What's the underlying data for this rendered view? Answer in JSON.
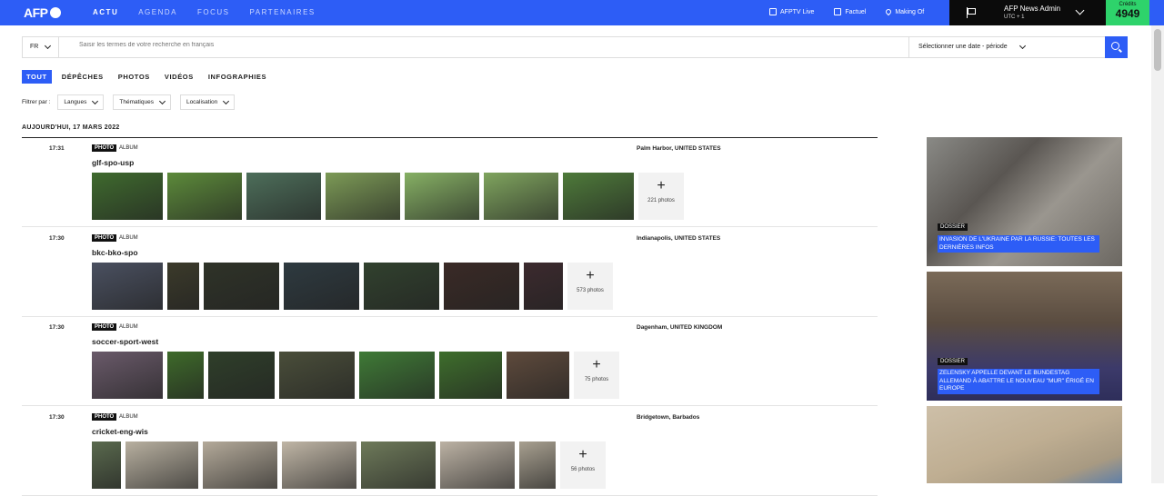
{
  "topbar": {
    "logo": "AFP",
    "nav": [
      "ACTU",
      "AGENDA",
      "FOCUS",
      "PARTENAIRES"
    ],
    "links": [
      {
        "icon": "tv-icon",
        "label": "AFPTV Live"
      },
      {
        "icon": "checklist-icon",
        "label": "Factuel"
      },
      {
        "icon": "location-pin-icon",
        "label": "Making Of"
      }
    ],
    "user": {
      "name": "AFP News Admin",
      "timezone": "UTC + 1"
    },
    "credits": {
      "label": "Crédits",
      "value": "4949"
    }
  },
  "search": {
    "language": "FR",
    "placeholder": "Saisir les termes de votre recherche en français",
    "date_placeholder": "Sélectionner une date - période"
  },
  "tabs": [
    "TOUT",
    "DÉPÊCHES",
    "PHOTOS",
    "VIDÉOS",
    "INFOGRAPHIES"
  ],
  "filters": {
    "label": "Filtrer par :",
    "options": [
      "Langues",
      "Thématiques",
      "Localisation"
    ]
  },
  "date_heading": "AUJOURD'HUI, 17 MARS 2022",
  "feed": [
    {
      "time": "17:31",
      "type": "PHOTO",
      "sub": "ALBUM",
      "title": "glf-spo-usp",
      "location": "Palm Harbor, UNITED STATES",
      "more": "221 photos",
      "thumbs": [
        "#3f6a2e",
        "#5c8a3a",
        "#4d6e5a",
        "#7c9a56",
        "#86b064",
        "#7fa45e",
        "#4e7a3a"
      ]
    },
    {
      "time": "17:30",
      "type": "PHOTO",
      "sub": "ALBUM",
      "title": "bkc-bko-spo",
      "location": "Indianapolis, UNITED STATES",
      "more": "573 photos",
      "thumbs": [
        "#4a5060",
        "#3b3a2a",
        "#2f3328",
        "#2e3a40",
        "#31412e",
        "#3a2a26",
        "#3c2a2e"
      ]
    },
    {
      "time": "17:30",
      "type": "PHOTO",
      "sub": "ALBUM",
      "title": "soccer-sport-west",
      "location": "Dagenham, UNITED KINGDOM",
      "more": "75 photos",
      "thumbs": [
        "#6a5a6a",
        "#3e6a2a",
        "#2f3f2a",
        "#4a4e3a",
        "#3f7a36",
        "#3e6e2c",
        "#5e4a3c"
      ]
    },
    {
      "time": "17:30",
      "type": "PHOTO",
      "sub": "ALBUM",
      "title": "cricket-eng-wis",
      "location": "Bridgetown, Barbados",
      "more": "56 photos",
      "thumbs": [
        "#5a6a4e",
        "#b8b0a0",
        "#b4aa9a",
        "#c0b6a6",
        "#6e7a5a",
        "#bcb2a4",
        "#a8a090"
      ]
    }
  ],
  "side": [
    {
      "badge": "DOSSIER",
      "title": "INVASION DE L'UKRAINE PAR LA RUSSIE: TOUTES LES DERNIÈRES INFOS"
    },
    {
      "badge": "DOSSIER",
      "title": "ZELENSKY APPELLE DEVANT LE BUNDESTAG ALLEMAND À ABATTRE LE NOUVEAU \"MUR\" ÉRIGÉ EN EUROPE"
    },
    {
      "badge": "",
      "title": ""
    }
  ],
  "colors": {
    "accent": "#2d5df6",
    "credits": "#2ed36b",
    "dark": "#0b0b0b"
  }
}
